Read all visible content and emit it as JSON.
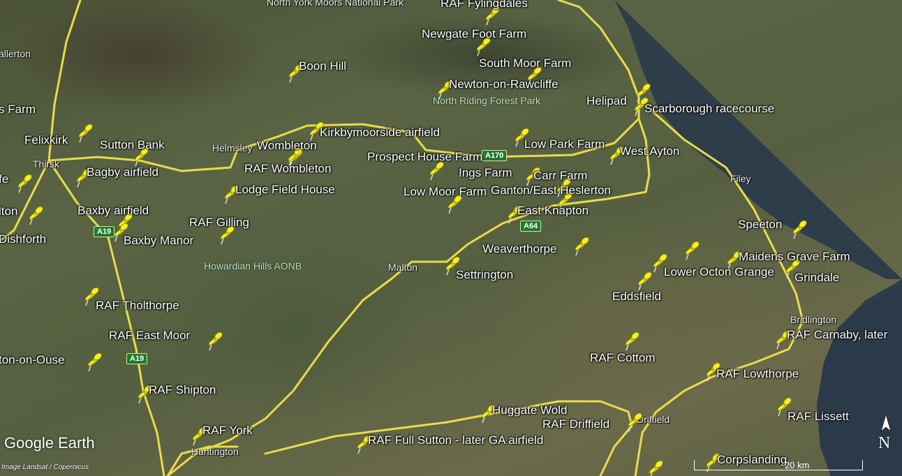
{
  "map": {
    "brand": "Google Earth",
    "credit": "Image Landsat / Copernicus",
    "scale_label": "20 km",
    "compass_label": "N"
  },
  "placemarks": [
    {
      "label": "RAF Fylingdales"
    },
    {
      "label": "Newgate Foot Farm"
    },
    {
      "label": "South Moor Farm"
    },
    {
      "label": "Newton-on-Rawcliffe"
    },
    {
      "label": "Boon Hill"
    },
    {
      "label": "Helipad"
    },
    {
      "label": "Scarborough racecourse"
    },
    {
      "label": "Felixkirk"
    },
    {
      "label": "Sutton Bank"
    },
    {
      "label": "Kirkbymoorside airfield"
    },
    {
      "label": "Wombleton"
    },
    {
      "label": "RAF Wombleton"
    },
    {
      "label": "Low Park Farm"
    },
    {
      "label": "West Ayton"
    },
    {
      "label": "Prospect House Farm"
    },
    {
      "label": "Bagby airfield"
    },
    {
      "label": "Ings Farm"
    },
    {
      "label": "Carr Farm"
    },
    {
      "label": "Lodge Field House"
    },
    {
      "label": "Low Moor Farm"
    },
    {
      "label": "Ganton/East Heslerton"
    },
    {
      "label": "Baxby airfield"
    },
    {
      "label": "East Knapton"
    },
    {
      "label": "RAF Gilling"
    },
    {
      "label": "Baxby Manor"
    },
    {
      "label": "Speeton"
    },
    {
      "label": "Weaverthorpe"
    },
    {
      "label": "Maidens Grave Farm"
    },
    {
      "label": "Settrington"
    },
    {
      "label": "Lower Octon Grange"
    },
    {
      "label": "Grindale"
    },
    {
      "label": "Eddsfield"
    },
    {
      "label": "RAF Tholthorpe"
    },
    {
      "label": "RAF East Moor"
    },
    {
      "label": "RAF Carnaby, later"
    },
    {
      "label": "RAF Cottom"
    },
    {
      "label": "RAF Lowthorpe"
    },
    {
      "label": "RAF Shipton"
    },
    {
      "label": "Huggate Wold"
    },
    {
      "label": "RAF Driffield"
    },
    {
      "label": "RAF Lissett"
    },
    {
      "label": "RAF York"
    },
    {
      "label": "RAF Full Sutton - later GA airfield"
    },
    {
      "label": "Corpslanding"
    },
    {
      "label": "ton-on-Ouse"
    }
  ],
  "places": [
    {
      "label": "allerton"
    },
    {
      "label": "s Farm"
    },
    {
      "label": "Helmsley"
    },
    {
      "label": "Thirsk"
    },
    {
      "label": "fe"
    },
    {
      "label": "lton"
    },
    {
      "label": "Dishforth"
    },
    {
      "label": "Malton"
    },
    {
      "label": "Filey"
    },
    {
      "label": "Bridlington"
    },
    {
      "label": "Driffield"
    },
    {
      "label": "Huntington"
    },
    {
      "label": "North York Moors National Park"
    }
  ],
  "parks": [
    {
      "label": "North Riding Forest Park"
    },
    {
      "label": "Howardian Hills AONB"
    }
  ],
  "road_shields": [
    {
      "label": "A19"
    },
    {
      "label": "A19"
    },
    {
      "label": "A64"
    },
    {
      "label": "A170"
    }
  ],
  "colors": {
    "road": "#f2e34a",
    "pin": "#f5ef1e",
    "sea": "#2e3d4a",
    "park_text": "#b9e6c9"
  }
}
